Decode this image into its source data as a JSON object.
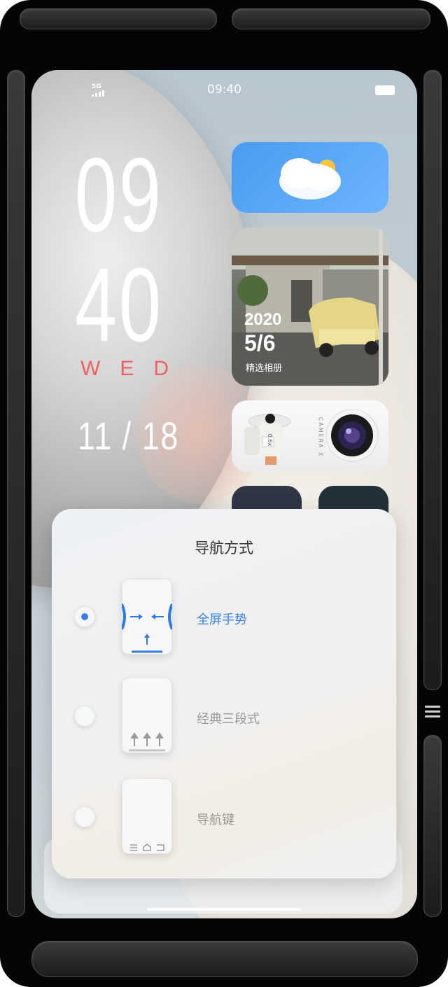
{
  "status_bar": {
    "network": "5G",
    "time": "09:40"
  },
  "clock_widget": {
    "hours": "09",
    "minutes": "40",
    "weekday": "WED",
    "date": "11 / 18"
  },
  "photo_widget": {
    "year": "2020",
    "day": "5/6",
    "caption": "精选相册"
  },
  "camera_widget": {
    "brand": "CAMERA X",
    "lens_label": "CAMERA",
    "lens_tag": "0.6x"
  },
  "nav_sheet": {
    "title": "导航方式",
    "selected_index": 0,
    "options": [
      {
        "label": "全屏手势"
      },
      {
        "label": "经典三段式"
      },
      {
        "label": "导航键"
      }
    ]
  },
  "colors": {
    "accent": "#3a82e8",
    "weekday": "#f06060"
  }
}
